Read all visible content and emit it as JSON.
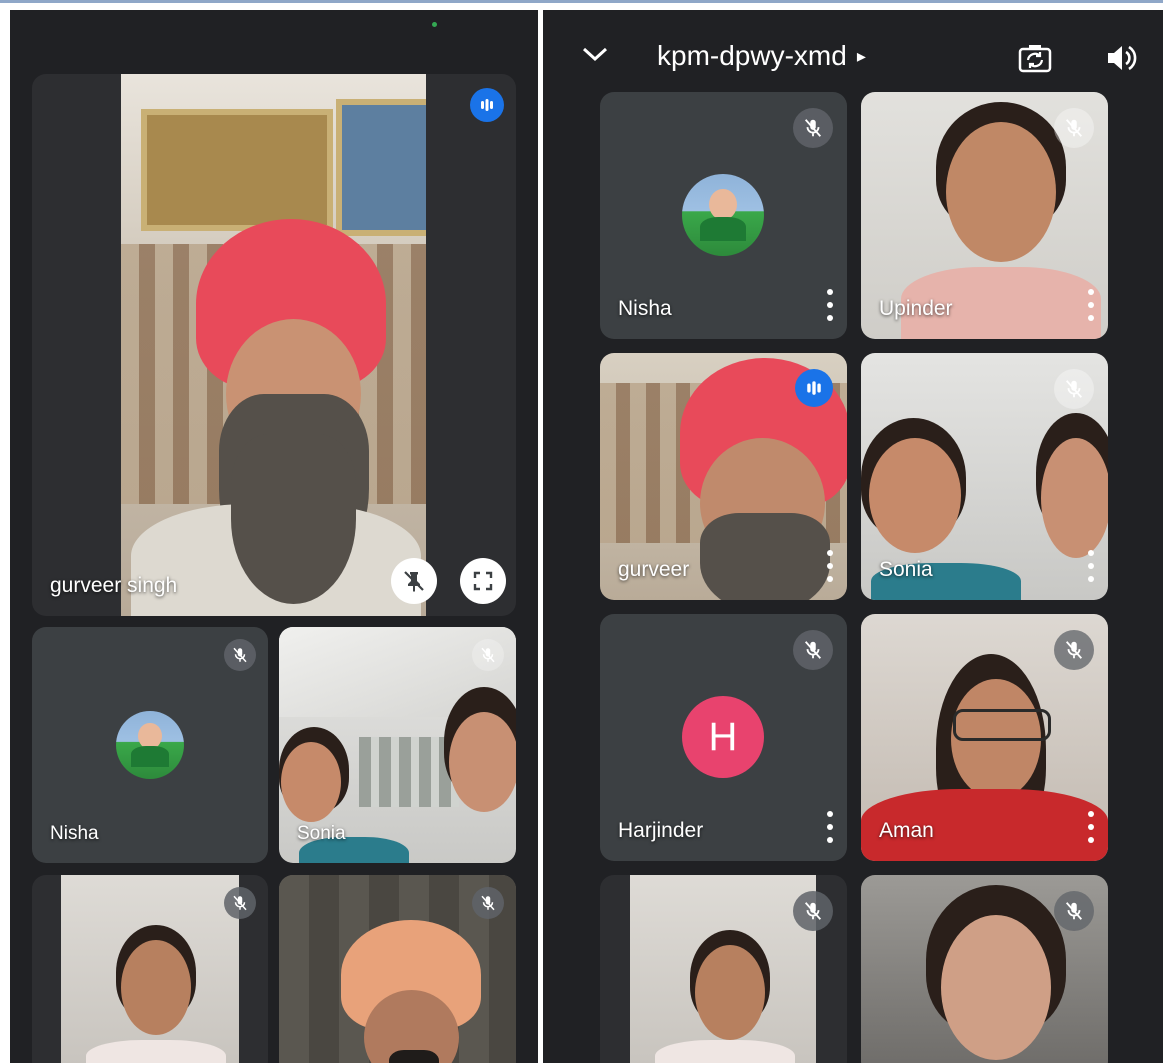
{
  "meeting": {
    "code": "kpm-dpwy-xmd",
    "code_arrow": "▸"
  },
  "left_panel": {
    "featured": {
      "name": "gurveer singh",
      "speaking": true
    },
    "tiles": [
      {
        "name": "Nisha",
        "muted": true
      },
      {
        "name": "Sonia",
        "muted": true
      },
      {
        "name": "",
        "muted": true
      },
      {
        "name": "",
        "muted": true
      }
    ]
  },
  "right_panel": {
    "tiles": [
      {
        "name": "Nisha",
        "muted": true
      },
      {
        "name": "Upinder",
        "muted": true
      },
      {
        "name": "gurveer",
        "speaking": true
      },
      {
        "name": "Sonia",
        "muted": true
      },
      {
        "name": "Harjinder",
        "muted": true,
        "initial": "H"
      },
      {
        "name": "Aman",
        "muted": true
      },
      {
        "name": "",
        "muted": true
      },
      {
        "name": "",
        "muted": true
      }
    ]
  },
  "colors": {
    "background": "#202124",
    "tile": "#3c4043",
    "speaking_blue": "#1a73e8",
    "avatar_pink": "#e8436e"
  }
}
